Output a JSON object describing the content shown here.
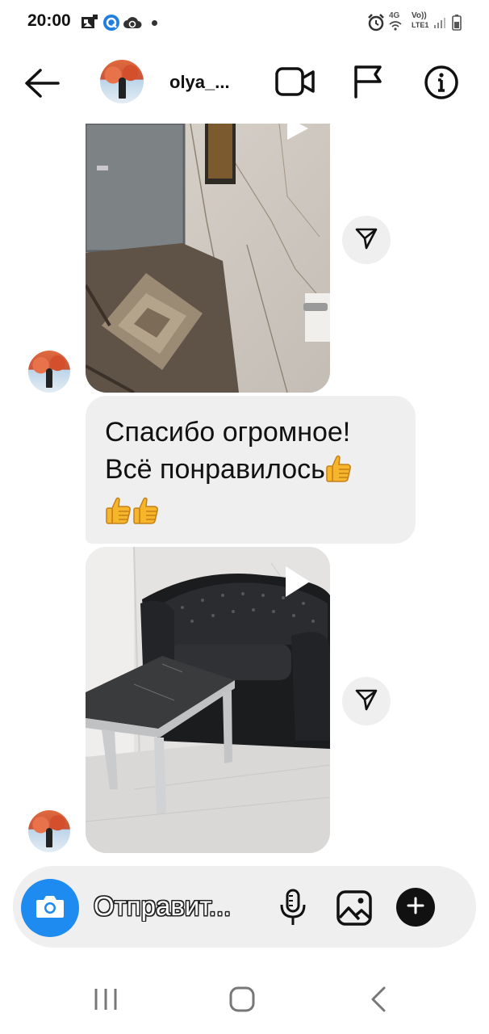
{
  "status_bar": {
    "time": "20:00",
    "network_label": "4G",
    "volte_label": "Vo))",
    "lte_label": "LTE1"
  },
  "header": {
    "username": "olya_..."
  },
  "messages": {
    "text_line1": "Спасибо огромное!",
    "text_line2": "Всё понравилось",
    "thumbs_emoji": "👍"
  },
  "composer": {
    "placeholder": "Отправит..."
  },
  "colors": {
    "camera_button": "#1d8bf0",
    "bubble_bg": "#efefef",
    "composer_bg": "#efefef"
  },
  "icons": {
    "back": "back-arrow-icon",
    "video": "video-call-icon",
    "flag": "flag-icon",
    "info": "info-icon",
    "share": "share-icon",
    "play": "play-icon",
    "camera": "camera-icon",
    "mic": "microphone-icon",
    "gallery": "gallery-icon",
    "plus": "plus-icon",
    "nav_recent": "recent-apps-icon",
    "nav_home": "home-icon",
    "nav_back": "nav-back-icon"
  }
}
